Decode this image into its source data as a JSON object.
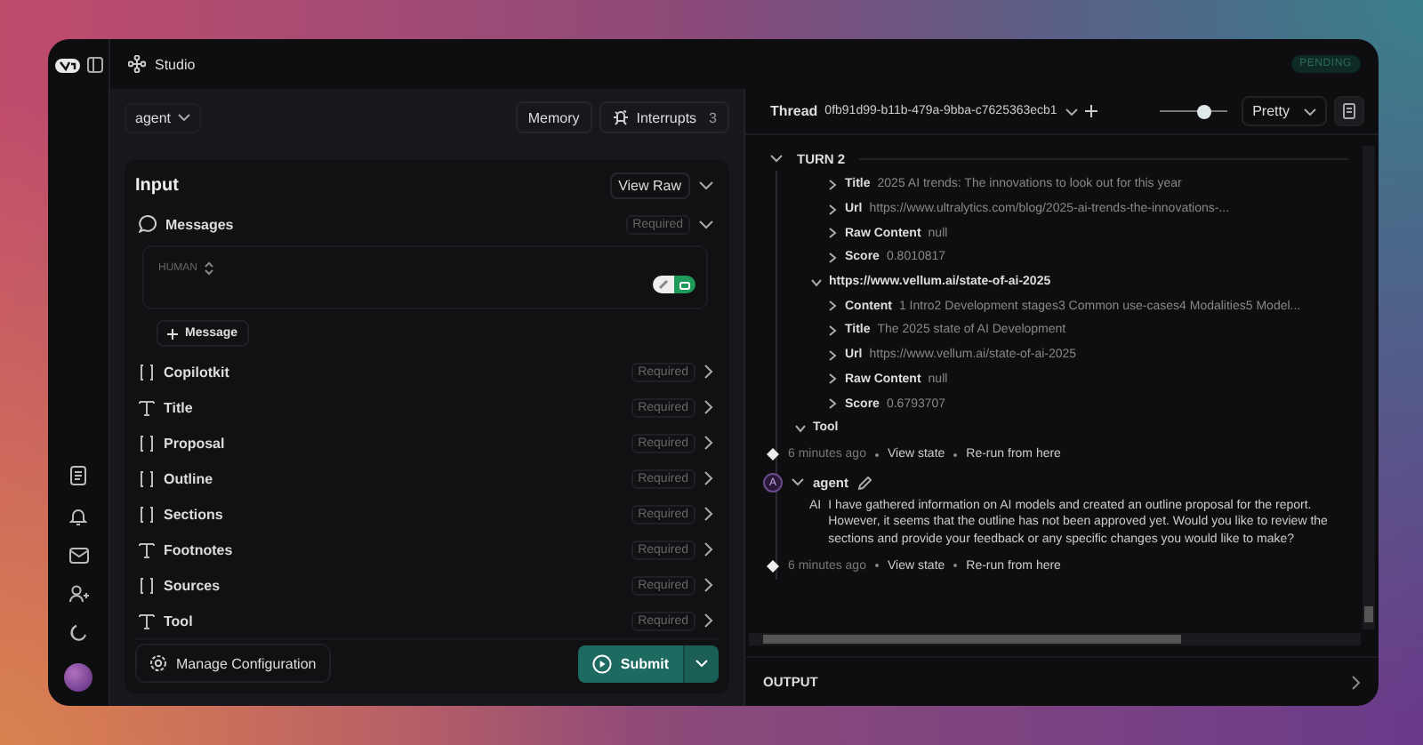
{
  "app": {
    "title": "Studio",
    "status": "PENDING"
  },
  "toolbar": {
    "graph": "agent",
    "memory": "Memory",
    "interrupts": "Interrupts",
    "interrupt_count": "3"
  },
  "input": {
    "title": "Input",
    "view_raw": "View Raw",
    "messages": {
      "label": "Messages",
      "required": "Required",
      "role": "HUMAN",
      "toggle_on": true,
      "add": "Message"
    },
    "fields": [
      {
        "kind": "object",
        "name": "Copilotkit",
        "required": "Required"
      },
      {
        "kind": "text",
        "name": "Title",
        "required": "Required"
      },
      {
        "kind": "object",
        "name": "Proposal",
        "required": "Required"
      },
      {
        "kind": "object",
        "name": "Outline",
        "required": "Required"
      },
      {
        "kind": "object",
        "name": "Sections",
        "required": "Required"
      },
      {
        "kind": "text",
        "name": "Footnotes",
        "required": "Required"
      },
      {
        "kind": "object",
        "name": "Sources",
        "required": "Required"
      },
      {
        "kind": "text",
        "name": "Tool",
        "required": "Required"
      }
    ],
    "manage": "Manage Configuration",
    "submit": "Submit"
  },
  "thread": {
    "label": "Thread",
    "id": "0fb91d99-b11b-479a-9bba-c7625363ecb1",
    "zoom": {
      "level": 0.65
    },
    "view": "Pretty"
  },
  "turn": {
    "label": "TURN 2",
    "expanded": true,
    "items": [
      {
        "kind": "tree",
        "nodes": [
          {
            "children": [
              {
                "children": [
                  {
                    "key": "Title",
                    "value": "2025 AI trends: The innovations to look out for this year",
                    "expanded": false
                  },
                  {
                    "key": "Url",
                    "value": "https://www.ultralytics.com/blog/2025-ai-trends-the-innovations-...",
                    "expanded": false
                  },
                  {
                    "key": "Raw Content",
                    "value": "null",
                    "expanded": false
                  },
                  {
                    "key": "Score",
                    "value": "0.8010817",
                    "expanded": false
                  }
                ]
              },
              {
                "key": "https://www.vellum.ai/state-of-ai-2025",
                "expanded": true,
                "children": [
                  {
                    "key": "Content",
                    "value": "1 Intro2 Development stages3 Common use-cases4 Modalities5 Model...",
                    "expanded": false
                  },
                  {
                    "key": "Title",
                    "value": "The 2025 state of AI Development",
                    "expanded": false
                  },
                  {
                    "key": "Url",
                    "value": "https://www.vellum.ai/state-of-ai-2025",
                    "expanded": false
                  },
                  {
                    "key": "Raw Content",
                    "value": "null",
                    "expanded": false
                  },
                  {
                    "key": "Score",
                    "value": "0.6793707",
                    "expanded": false
                  }
                ]
              }
            ]
          },
          {
            "key": "Tool",
            "expanded": true
          }
        ]
      },
      {
        "kind": "event",
        "time": "6 minutes ago",
        "view": "View state",
        "rerun": "Re-run from here"
      },
      {
        "kind": "message",
        "avatar": "A",
        "name": "agent",
        "expanded": true,
        "role": "AI",
        "text": "I have gathered information on AI models and created an outline proposal for the report. However, it seems that the outline has not been approved yet. Would you like to review the sections and provide your feedback or any specific changes you would like to make?"
      },
      {
        "kind": "event",
        "time": "6 minutes ago",
        "view": "View state",
        "rerun": "Re-run from here"
      }
    ]
  },
  "output": {
    "label": "OUTPUT"
  }
}
